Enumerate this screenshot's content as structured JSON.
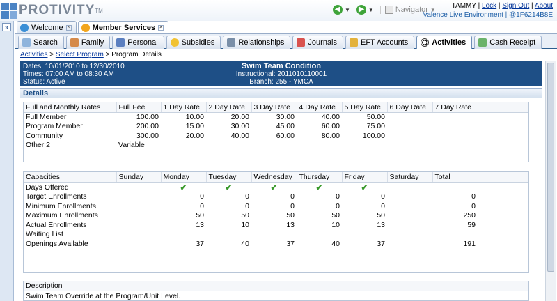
{
  "app": {
    "logo_text": "PROTIVITY",
    "logo_tm": "TM"
  },
  "nav": {
    "navigator_label": "Navigator"
  },
  "user": {
    "name": "TAMMY",
    "lock": "Lock",
    "sign_out": "Sign Out",
    "about": "About",
    "environment": "Valence Live Environment",
    "instance": "@1F6214B8E",
    "sep": "|"
  },
  "workspace_tabs": [
    {
      "label": "Welcome",
      "icon": "globe-icon",
      "active": false
    },
    {
      "label": "Member Services",
      "icon": "flower-icon",
      "active": true
    }
  ],
  "module_tabs": [
    {
      "label": "Search",
      "icon": "magnifier-icon"
    },
    {
      "label": "Family",
      "icon": "family-icon"
    },
    {
      "label": "Personal",
      "icon": "person-icon"
    },
    {
      "label": "Subsidies",
      "icon": "coin-icon"
    },
    {
      "label": "Relationships",
      "icon": "people-icon"
    },
    {
      "label": "Journals",
      "icon": "journal-icon"
    },
    {
      "label": "EFT Accounts",
      "icon": "coins-icon"
    },
    {
      "label": "Activities",
      "icon": "soccer-ball-icon"
    },
    {
      "label": "Cash Receipt",
      "icon": "cash-icon"
    }
  ],
  "breadcrumb": {
    "activities": "Activities",
    "sep1": ">",
    "select_program": "Select Program",
    "sep2": ">",
    "current": "Program Details"
  },
  "banner": {
    "dates": "Dates: 10/01/2010 to 12/30/2010",
    "times": "Times: 07:00 AM to 08:30 AM",
    "status": "Status: Active",
    "title": "Swim Team Condition",
    "instructional": "Instructional: 2011010110001",
    "branch": "Branch: 255 - YMCA"
  },
  "details_label": "Details",
  "rates": {
    "headers": [
      "Full and Monthly Rates",
      "Full Fee",
      "1 Day Rate",
      "2 Day Rate",
      "3 Day Rate",
      "4 Day Rate",
      "5 Day Rate",
      "6 Day Rate",
      "7 Day Rate"
    ],
    "rows": [
      [
        "Full Member",
        "100.00",
        "10.00",
        "20.00",
        "30.00",
        "40.00",
        "50.00",
        "",
        ""
      ],
      [
        "Program Member",
        "200.00",
        "15.00",
        "30.00",
        "45.00",
        "60.00",
        "75.00",
        "",
        ""
      ],
      [
        "Community",
        "300.00",
        "20.00",
        "40.00",
        "60.00",
        "80.00",
        "100.00",
        "",
        ""
      ],
      [
        "Other 2",
        "Variable",
        "",
        "",
        "",
        "",
        "",
        "",
        ""
      ]
    ]
  },
  "capacities": {
    "headers": [
      "Capacities",
      "Sunday",
      "Monday",
      "Tuesday",
      "Wednesday",
      "Thursday",
      "Friday",
      "Saturday",
      "Total"
    ],
    "days_offered": {
      "label": "Days Offered",
      "checks": [
        false,
        true,
        true,
        true,
        true,
        true,
        false
      ],
      "check_glyph": "✔"
    },
    "rows": [
      [
        "Target Enrollments",
        "",
        "0",
        "0",
        "0",
        "0",
        "0",
        "",
        "0"
      ],
      [
        "Minimum Enrollments",
        "",
        "0",
        "0",
        "0",
        "0",
        "0",
        "",
        "0"
      ],
      [
        "Maximum Enrollments",
        "",
        "50",
        "50",
        "50",
        "50",
        "50",
        "",
        "250"
      ],
      [
        "Actual Enrollments",
        "",
        "13",
        "10",
        "13",
        "10",
        "13",
        "",
        "59"
      ],
      [
        "Waiting List",
        "",
        "",
        "",
        "",
        "",
        "",
        "",
        ""
      ],
      [
        "Openings Available",
        "",
        "37",
        "40",
        "37",
        "40",
        "37",
        "",
        "191"
      ]
    ]
  },
  "description": {
    "label": "Description",
    "text": "Swim Team Override at the Program/Unit Level."
  },
  "colors": {
    "banner": "#1e4f86",
    "check": "#3a9a2c",
    "link": "#003399"
  }
}
